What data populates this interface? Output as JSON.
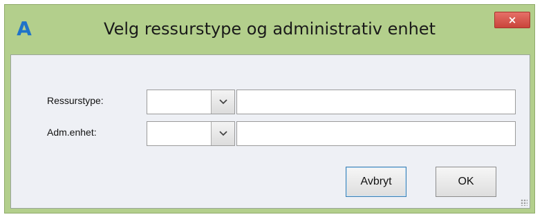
{
  "dialog": {
    "title": "Velg ressurstype og administrativ enhet",
    "close_label": "×",
    "app_icon_glyph": "A"
  },
  "form": {
    "ressurstype_label": "Ressurstype:",
    "ressurstype_code": "",
    "ressurstype_name": "",
    "adm_enhet_label": "Adm.enhet:",
    "adm_enhet_code": "",
    "adm_enhet_name": ""
  },
  "buttons": {
    "cancel_label": "Avbryt",
    "ok_label": "OK"
  },
  "colors": {
    "frame": "#b3cf8c",
    "close": "#c9443a",
    "client": "#eef0f5"
  }
}
